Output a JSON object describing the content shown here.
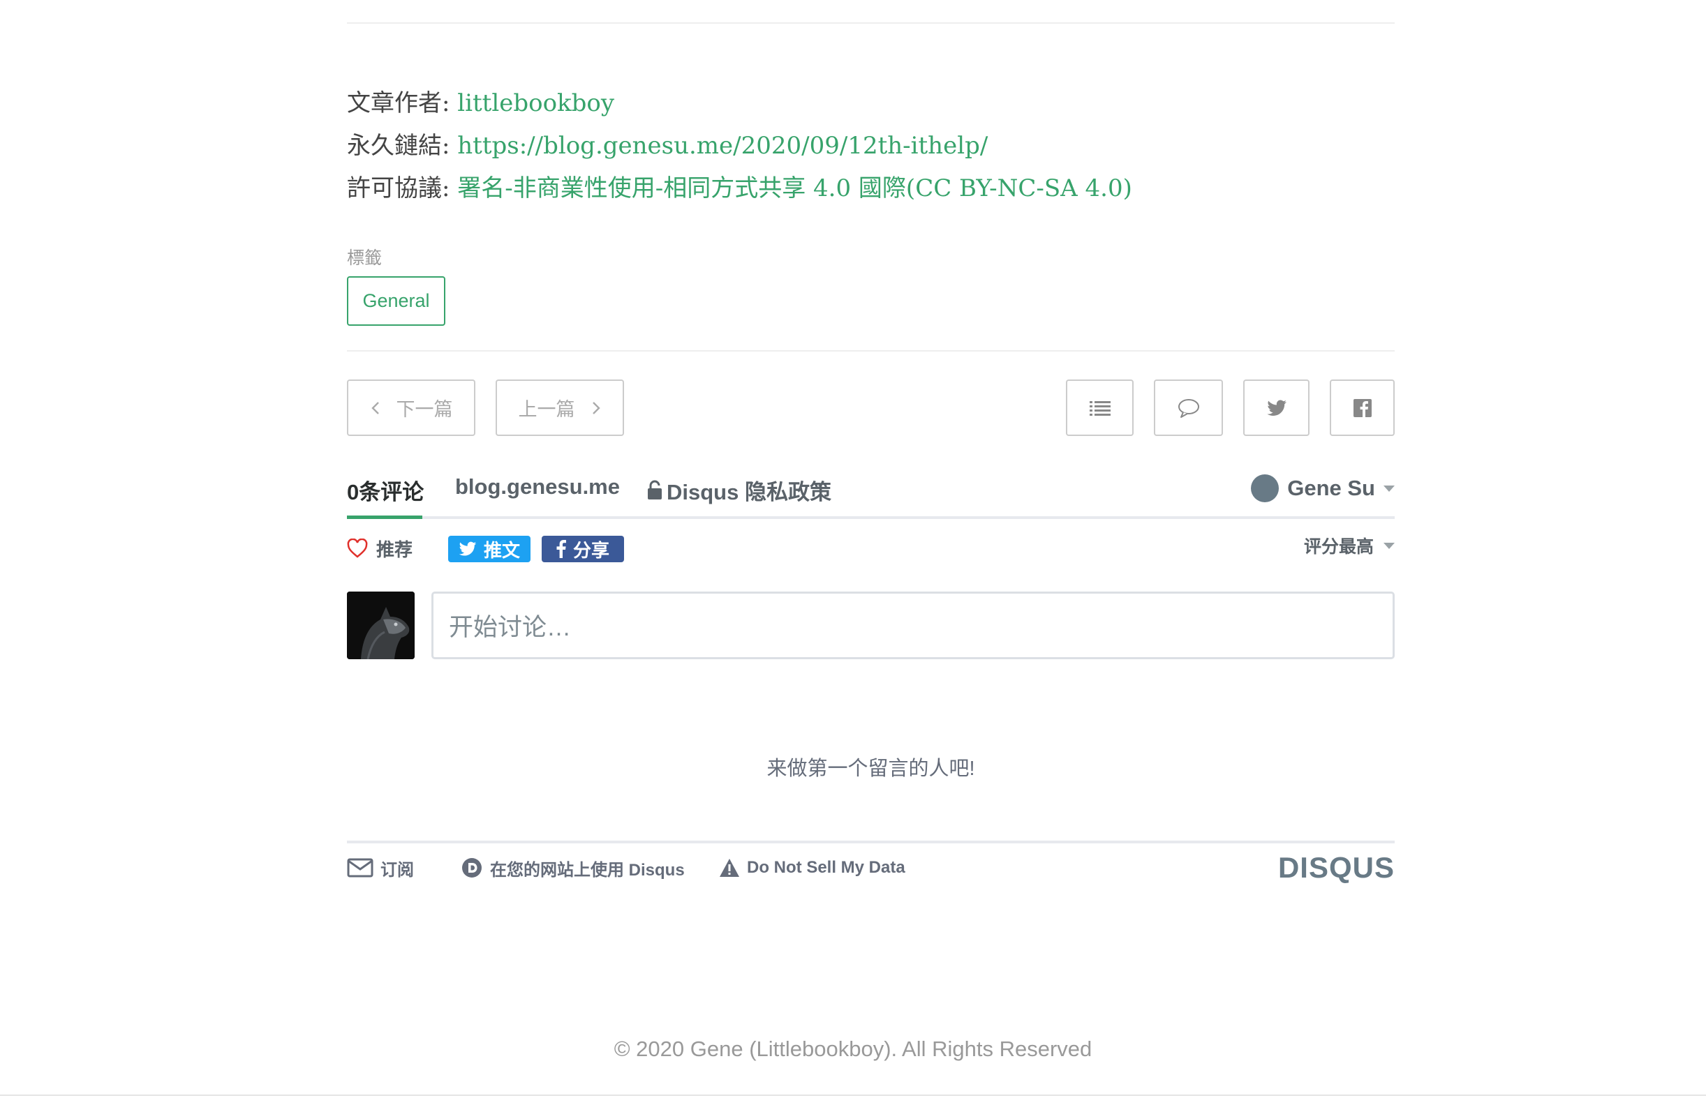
{
  "post_meta": {
    "author_label": "文章作者: ",
    "author": "littlebookboy",
    "permalink_label": "永久鏈結: ",
    "permalink": "https://blog.genesu.me/2020/09/12th-ithelp/",
    "license_label": "許可協議: ",
    "license": "署名-非商業性使用-相同方式共享 4.0 國際(CC BY-NC-SA 4.0)"
  },
  "tags": {
    "label": "標籤",
    "items": [
      "General"
    ]
  },
  "post_nav": {
    "next_label": "下一篇",
    "prev_label": "上一篇",
    "icons": [
      "list-icon",
      "comment-icon",
      "twitter-icon",
      "facebook-icon"
    ]
  },
  "disqus": {
    "tabs": {
      "comments": "0条评论",
      "site": "blog.genesu.me",
      "privacy": "Disqus 隐私政策"
    },
    "user_name": "Gene Su",
    "recommend_label": "推荐",
    "tweet_label": "推文",
    "share_label": "分享",
    "sort_label": "评分最高",
    "input_placeholder": "开始讨论…",
    "empty_message": "来做第一个留言的人吧!",
    "footer": {
      "subscribe": "订阅",
      "add_disqus": "在您的网站上使用 Disqus",
      "do_not_sell": "Do Not Sell My Data",
      "brand": "DISQUS"
    },
    "colors": {
      "accent": "#37a36b",
      "twitter": "#1da1f2",
      "facebook": "#3b5998"
    }
  },
  "footer": {
    "copyright": "© 2020 Gene (Littlebookboy). All Rights Reserved"
  }
}
